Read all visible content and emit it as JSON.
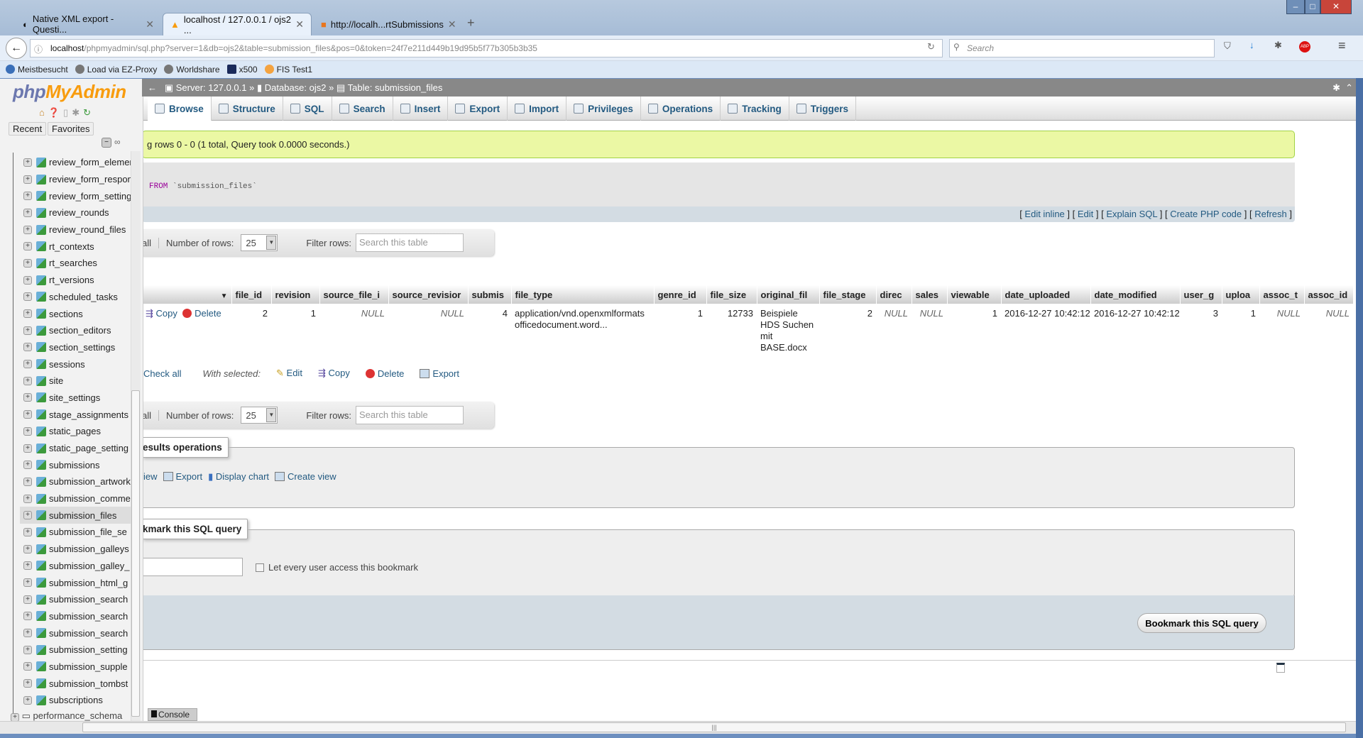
{
  "browser": {
    "tabs": [
      {
        "label": "Native XML export - Questi...",
        "active": false
      },
      {
        "label": "localhost / 127.0.0.1 / ojs2 ...",
        "active": true
      },
      {
        "label": "http://localh...rtSubmissions",
        "active": false
      }
    ],
    "url_host": "localhost",
    "url_path": "/phpmyadmin/sql.php?server=1&db=ojs2&table=submission_files&pos=0&token=24f7e211d449b19d95b5f77b305b3b35",
    "search_placeholder": "Search",
    "bookmarks": [
      "Meistbesucht",
      "Load via EZ-Proxy",
      "Worldshare",
      "x500",
      "FIS Test1"
    ]
  },
  "sidebar": {
    "logo": {
      "php": "php",
      "myadmin": "MyAdmin"
    },
    "recent": "Recent",
    "favorites": "Favorites",
    "tables": [
      "review_form_elemen",
      "review_form_respon",
      "review_form_setting",
      "review_rounds",
      "review_round_files",
      "rt_contexts",
      "rt_searches",
      "rt_versions",
      "scheduled_tasks",
      "sections",
      "section_editors",
      "section_settings",
      "sessions",
      "site",
      "site_settings",
      "stage_assignments",
      "static_pages",
      "static_page_setting",
      "submissions",
      "submission_artwork",
      "submission_comme",
      "submission_files",
      "submission_file_se",
      "submission_galleys",
      "submission_galley_",
      "submission_html_g",
      "submission_search",
      "submission_search",
      "submission_search",
      "submission_setting",
      "submission_supple",
      "submission_tombst",
      "subscriptions"
    ],
    "selected": "submission_files",
    "next_db": "performance_schema"
  },
  "breadcrumb": {
    "server": "Server: 127.0.0.1",
    "database": "Database: ojs2",
    "table": "Table: submission_files",
    "sep": "»"
  },
  "tabs": [
    "Browse",
    "Structure",
    "SQL",
    "Search",
    "Insert",
    "Export",
    "Import",
    "Privileges",
    "Operations",
    "Tracking",
    "Triggers"
  ],
  "active_tab": "Browse",
  "message": "g rows 0 - 0 (1 total, Query took 0.0000 seconds.)",
  "sql": {
    "keyword": "FROM",
    "table": "`submission_files`"
  },
  "sql_links": [
    "Edit inline",
    "Edit",
    "Explain SQL",
    "Create PHP code",
    "Refresh"
  ],
  "nav": {
    "show_all": "all",
    "rows_label": "Number of rows:",
    "rows_value": "25",
    "filter_label": "Filter rows:",
    "filter_placeholder": "Search this table"
  },
  "table": {
    "columns": [
      "file_id",
      "revision",
      "source_file_i",
      "source_revisior",
      "submis",
      "file_type",
      "genre_id",
      "file_size",
      "original_fil",
      "file_stage",
      "direc",
      "sales",
      "viewable",
      "date_uploaded",
      "date_modified",
      "user_g",
      "uploa",
      "assoc_t",
      "assoc_id"
    ],
    "row_actions": {
      "copy": "Copy",
      "delete": "Delete"
    },
    "rows": [
      [
        "2",
        "1",
        "NULL",
        "NULL",
        "4",
        "application/vnd.openxmlformats officedocument.word...",
        "1",
        "12733",
        "Beispiele HDS Suchen mit BASE.docx",
        "2",
        "NULL",
        "NULL",
        "1",
        "2016-12-27 10:42:12",
        "2016-12-27 10:42:12",
        "3",
        "1",
        "NULL",
        "NULL"
      ]
    ]
  },
  "bulk": {
    "check_all": "Check all",
    "with_selected": "With selected:",
    "edit": "Edit",
    "copy": "Copy",
    "delete": "Delete",
    "export": "Export"
  },
  "results_ops": {
    "legend": "esults operations",
    "items": [
      "iew",
      "Export",
      "Display chart",
      "Create view"
    ]
  },
  "bookmark": {
    "legend": "kmark this SQL query",
    "checkbox": "Let every user access this bookmark",
    "button": "Bookmark this SQL query"
  },
  "console": "Console"
}
